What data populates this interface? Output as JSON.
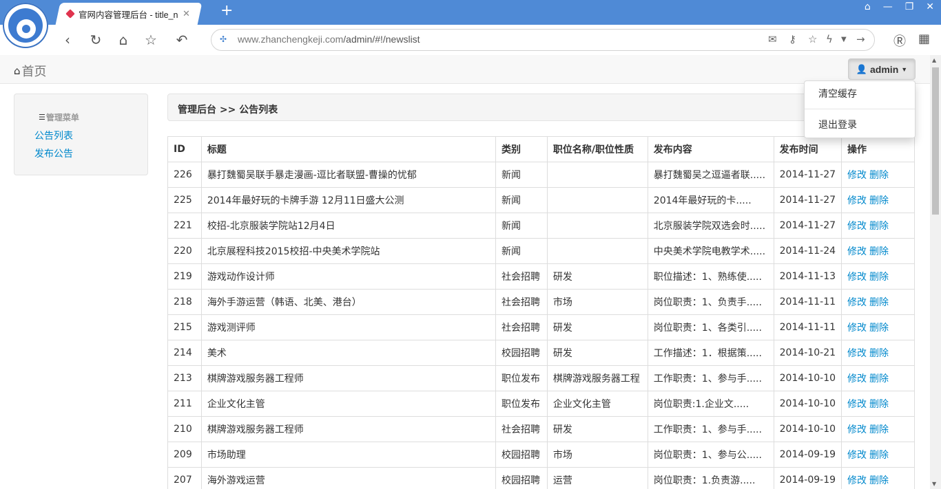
{
  "browser": {
    "tab_title": "官网内容管理后台 - title_n",
    "url_host": "www.zhanchengkeji.com",
    "url_path": "/admin/#!/newslist",
    "new_tab_symbol": "+",
    "window_controls": [
      "⌂",
      "—",
      "❐",
      "✕"
    ]
  },
  "navbar": {
    "brand": "首页",
    "user_label": "admin"
  },
  "dropdown": {
    "items": [
      "清空缓存",
      "退出登录"
    ]
  },
  "sidebar": {
    "header": "管理菜单",
    "links": [
      "公告列表",
      "发布公告"
    ]
  },
  "breadcrumb": "管理后台 >> 公告列表",
  "table": {
    "headers": [
      "ID",
      "标题",
      "类别",
      "职位名称/职位性质",
      "发布内容",
      "发布时间",
      "操作"
    ],
    "edit_label": "修改",
    "delete_label": "删除",
    "rows": [
      {
        "id": "226",
        "title": "暴打魏蜀吴联手暴走漫画-逗比者联盟-曹操的忧郁",
        "category": "新闻",
        "position": "",
        "content": "暴打魏蜀吴之逗逼者联.....",
        "date": "2014-11-27"
      },
      {
        "id": "225",
        "title": "2014年最好玩的卡牌手游 12月11日盛大公测",
        "category": "新闻",
        "position": "",
        "content": "2014年最好玩的卡.....",
        "date": "2014-11-27"
      },
      {
        "id": "221",
        "title": "校招-北京服装学院站12月4日",
        "category": "新闻",
        "position": "",
        "content": "北京服装学院双选会时.....",
        "date": "2014-11-27"
      },
      {
        "id": "220",
        "title": "北京展程科技2015校招-中央美术学院站",
        "category": "新闻",
        "position": "",
        "content": "中央美术学院电教学术.....",
        "date": "2014-11-24"
      },
      {
        "id": "219",
        "title": "游戏动作设计师",
        "category": "社会招聘",
        "position": "研发",
        "content": "职位描述：1、熟练使.....",
        "date": "2014-11-13"
      },
      {
        "id": "218",
        "title": "海外手游运营（韩语、北美、港台）",
        "category": "社会招聘",
        "position": "市场",
        "content": "岗位职责：1、负责手.....",
        "date": "2014-11-11"
      },
      {
        "id": "215",
        "title": "游戏测评师",
        "category": "社会招聘",
        "position": "研发",
        "content": "岗位职责：1、各类引.....",
        "date": "2014-11-11"
      },
      {
        "id": "214",
        "title": "美术",
        "category": "校园招聘",
        "position": "研发",
        "content": "工作描述：1．根据策.....",
        "date": "2014-10-21"
      },
      {
        "id": "213",
        "title": "棋牌游戏服务器工程师",
        "category": "职位发布",
        "position": "棋牌游戏服务器工程",
        "content": "工作职责：1、参与手.....",
        "date": "2014-10-10"
      },
      {
        "id": "211",
        "title": "企业文化主管",
        "category": "职位发布",
        "position": "企业文化主管",
        "content": "岗位职责:1.企业文.....",
        "date": "2014-10-10"
      },
      {
        "id": "210",
        "title": "棋牌游戏服务器工程师",
        "category": "社会招聘",
        "position": "研发",
        "content": "工作职责：1、参与手.....",
        "date": "2014-10-10"
      },
      {
        "id": "209",
        "title": "市场助理",
        "category": "校园招聘",
        "position": "市场",
        "content": "岗位职责：1、参与公.....",
        "date": "2014-09-19"
      },
      {
        "id": "207",
        "title": "海外游戏运营",
        "category": "校园招聘",
        "position": "运营",
        "content": "岗位职责：1.负责游.....",
        "date": "2014-09-19"
      }
    ]
  },
  "colors": {
    "titlebar": "#4f8ad6",
    "link": "#0088cc"
  }
}
